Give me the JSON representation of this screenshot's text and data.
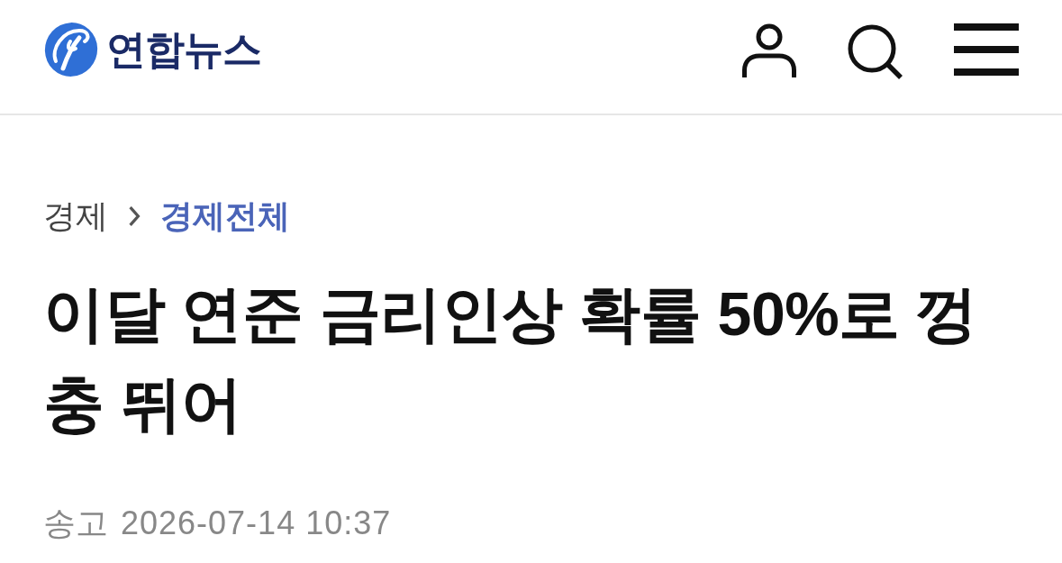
{
  "header": {
    "logo_text": "연합뉴스"
  },
  "breadcrumb": [
    {
      "label": "경제",
      "selected": false
    },
    {
      "label": "경제전체",
      "selected": true
    }
  ],
  "article": {
    "title": "이달 연준 금리인상 확률 50%로 껑충 뛰어",
    "meta_label": "송고",
    "published": "2026-07-14 10:37"
  }
}
